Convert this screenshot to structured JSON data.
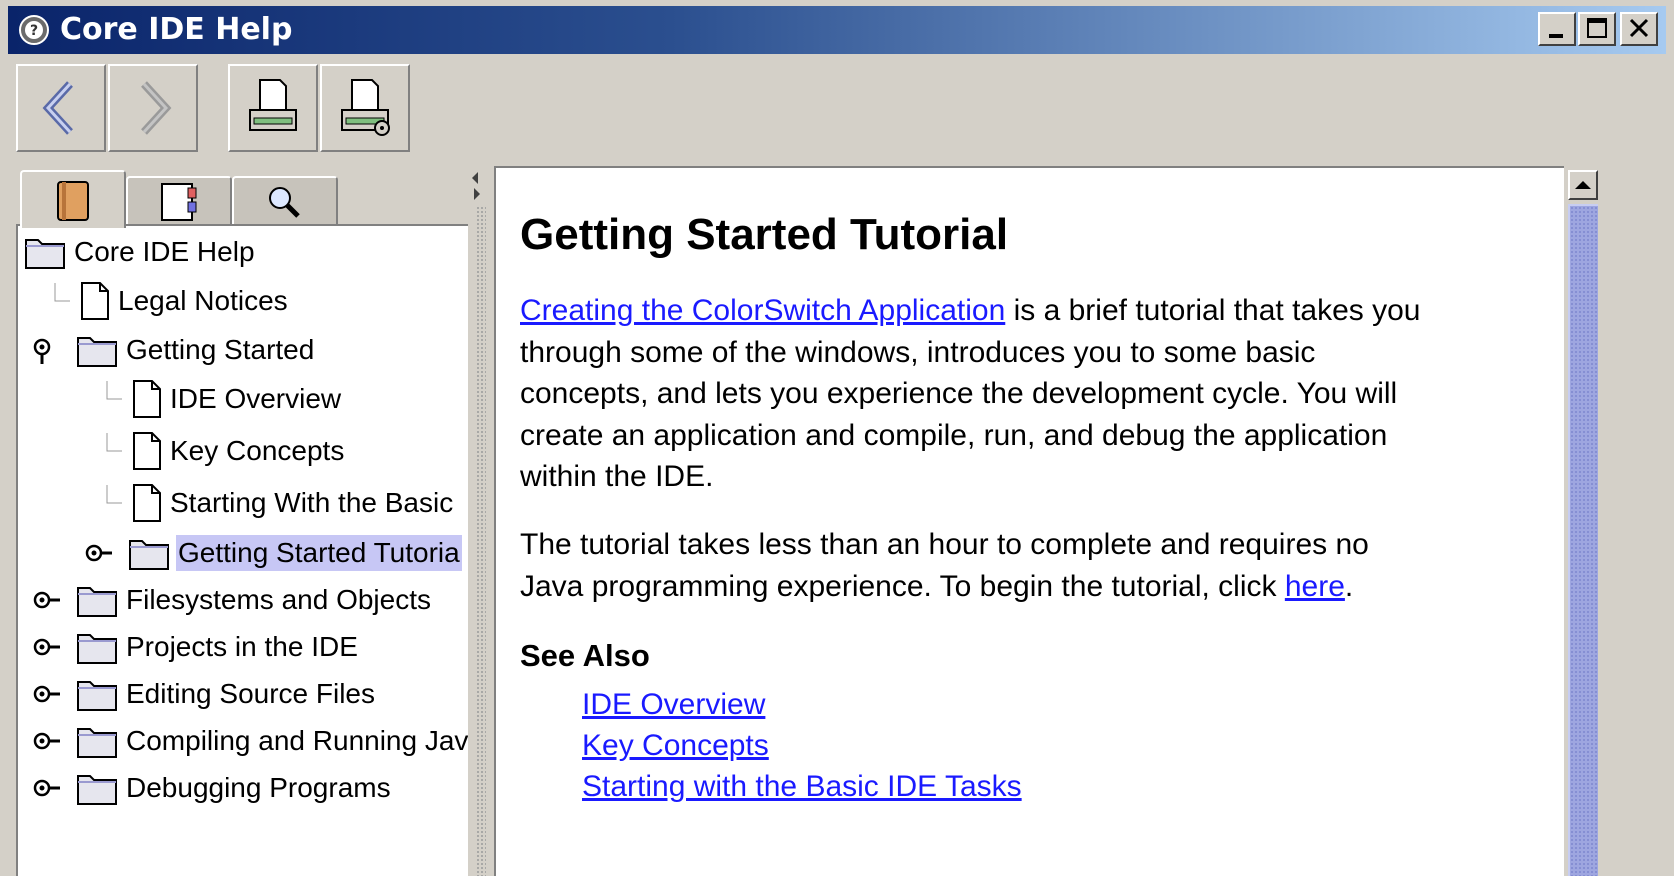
{
  "window": {
    "title": "Core IDE Help",
    "controls": [
      "minimize",
      "maximize",
      "close"
    ]
  },
  "toolbar": {
    "buttons": [
      {
        "name": "back",
        "icon": "back-arrow-icon"
      },
      {
        "name": "forward",
        "icon": "forward-arrow-icon"
      },
      {
        "name": "print",
        "icon": "printer-icon"
      },
      {
        "name": "page-setup",
        "icon": "print-setup-icon"
      }
    ]
  },
  "navigator": {
    "tabs": [
      {
        "name": "contents",
        "icon": "book-icon",
        "active": true
      },
      {
        "name": "index",
        "icon": "index-icon",
        "active": false
      },
      {
        "name": "search",
        "icon": "magnifier-icon",
        "active": false
      }
    ],
    "tree": [
      {
        "label": "Core IDE Help",
        "type": "folder",
        "depth": 0
      },
      {
        "label": "Legal Notices",
        "type": "page",
        "depth": 1
      },
      {
        "label": "Getting Started",
        "type": "folder",
        "depth": 1,
        "expanded": true
      },
      {
        "label": "IDE Overview",
        "type": "page",
        "depth": 2
      },
      {
        "label": "Key Concepts",
        "type": "page",
        "depth": 2
      },
      {
        "label": "Starting With the Basic",
        "type": "page",
        "depth": 2
      },
      {
        "label": "Getting Started Tutoria",
        "type": "folder",
        "depth": 2,
        "selected": true
      },
      {
        "label": "Filesystems and Objects",
        "type": "folder",
        "depth": 1
      },
      {
        "label": "Projects in the IDE",
        "type": "folder",
        "depth": 1
      },
      {
        "label": "Editing Source Files",
        "type": "folder",
        "depth": 1
      },
      {
        "label": "Compiling and Running Jav",
        "type": "folder",
        "depth": 1
      },
      {
        "label": "Debugging Programs",
        "type": "folder",
        "depth": 1
      }
    ]
  },
  "content": {
    "heading": "Getting Started Tutorial",
    "para1": {
      "link": "Creating the ColorSwitch Application",
      "line1": " is a brief tutorial that takes you",
      "line2": "through some of the windows, introduces you to some basic",
      "line3": "concepts, and lets you experience the development cycle. You will",
      "line4": "create an application and compile, run, and debug the application",
      "line5": "within the IDE."
    },
    "para2": {
      "line1": "The tutorial takes less than an hour to complete and requires no",
      "line2": "Java programming experience. To begin the tutorial, click ",
      "link": "here",
      "end": "."
    },
    "see_also_heading": "See Also",
    "see_also": [
      "IDE Overview",
      "Key Concepts",
      "Starting with the Basic IDE Tasks"
    ]
  },
  "colors": {
    "link": "#1a1aff",
    "selection": "#c7c7f5",
    "titlebar_start": "#0a246a",
    "titlebar_end": "#a6caf0"
  }
}
